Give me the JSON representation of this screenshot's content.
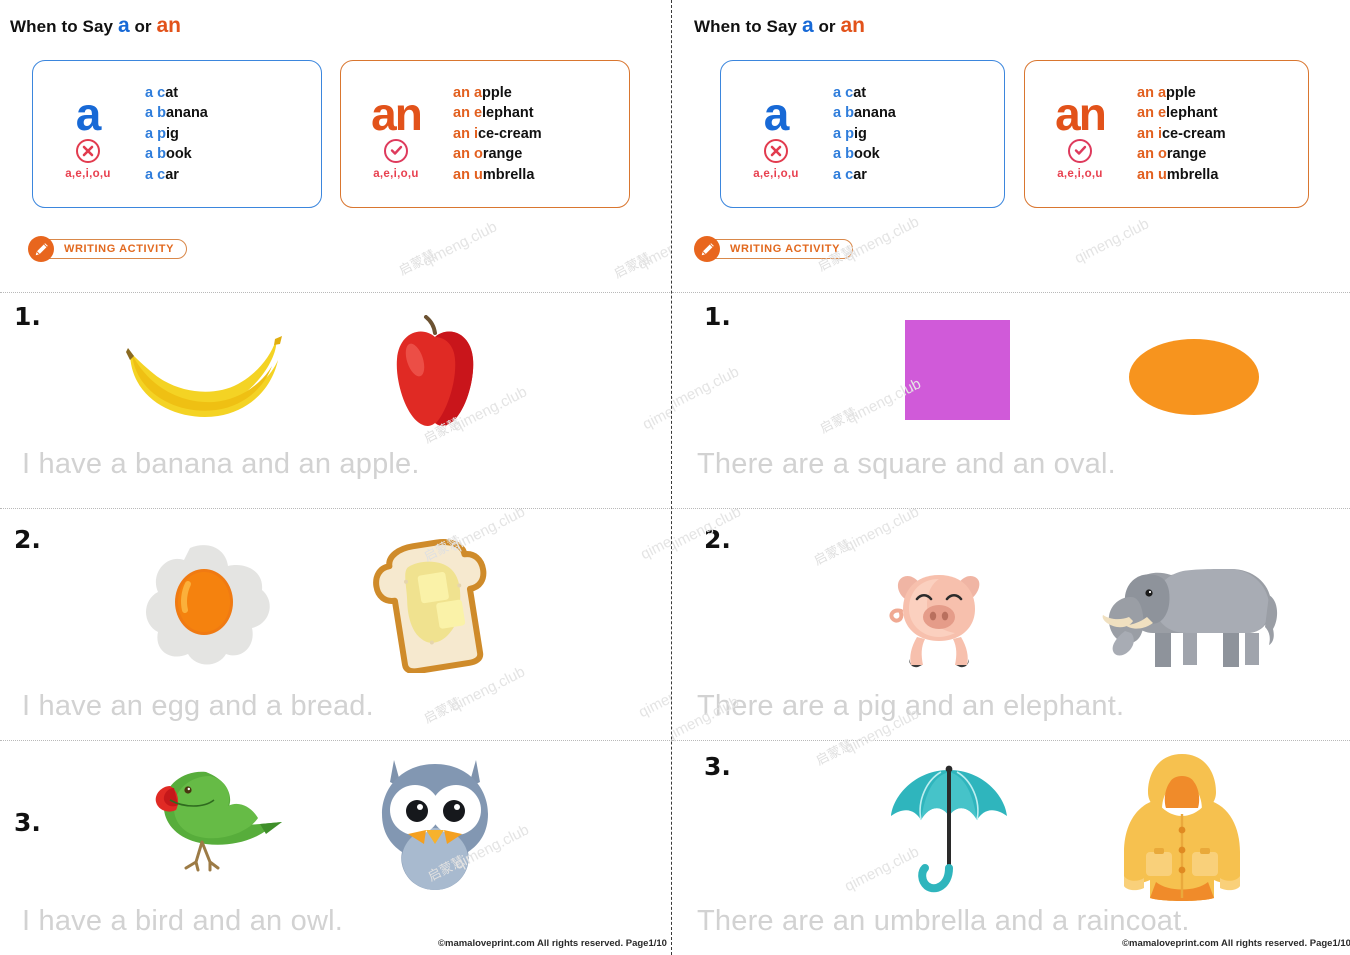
{
  "document": {
    "footer_note": "©mamaloveprint.com All rights reserved. Page1/10",
    "watermark_latin": "qimeng.club",
    "watermark_cjk": "启蒙慧"
  },
  "colors": {
    "blue": "#1769d6",
    "blue_light": "#2f7ddb",
    "orange": "#e2521a",
    "orange_light": "#e2601f",
    "red": "#e8404f",
    "badge_orange": "#e8661e",
    "sentence_gray": "#d2d2d2"
  },
  "header": {
    "title_prefix": "When to Say ",
    "title_a": "a",
    "title_or": " or ",
    "title_an": "an",
    "box_a": {
      "big_label": "a",
      "mark_icon": "cross-circle-icon",
      "vowels": "a,e,i,o,u",
      "examples": [
        {
          "article": "a",
          "initial": "c",
          "rest": "at"
        },
        {
          "article": "a",
          "initial": "b",
          "rest": "anana"
        },
        {
          "article": "a",
          "initial": "p",
          "rest": "ig"
        },
        {
          "article": "a",
          "initial": "b",
          "rest": "ook"
        },
        {
          "article": "a",
          "initial": "c",
          "rest": "ar"
        }
      ]
    },
    "box_an": {
      "big_label": "an",
      "mark_icon": "check-circle-icon",
      "vowels": "a,e,i,o,u",
      "examples": [
        {
          "article": "an",
          "initial": "a",
          "rest": "pple"
        },
        {
          "article": "an",
          "initial": "e",
          "rest": "lephant"
        },
        {
          "article": "an",
          "initial": "i",
          "rest": "ce-cream"
        },
        {
          "article": "an",
          "initial": "o",
          "rest": "range"
        },
        {
          "article": "an",
          "initial": "u",
          "rest": "mbrella"
        }
      ]
    },
    "badge": {
      "icon": "pencil-icon",
      "label": "WRITING ACTIVITY"
    }
  },
  "left_page": {
    "rows": [
      {
        "number": "1.",
        "sentence": "I have a banana and an apple.",
        "pictures": [
          "banana-illustration",
          "apple-illustration"
        ]
      },
      {
        "number": "2.",
        "sentence": "I have an egg and a bread.",
        "pictures": [
          "fried-egg-illustration",
          "toast-bread-illustration"
        ]
      },
      {
        "number": "3.",
        "sentence": "I have a bird and an owl.",
        "pictures": [
          "parrot-bird-illustration",
          "owl-illustration"
        ]
      }
    ]
  },
  "right_page": {
    "rows": [
      {
        "number": "1.",
        "sentence": "There are a square and an oval.",
        "pictures": [
          "magenta-square-shape",
          "orange-oval-shape"
        ]
      },
      {
        "number": "2.",
        "sentence": "There are a pig and an elephant.",
        "pictures": [
          "pig-illustration",
          "elephant-illustration"
        ]
      },
      {
        "number": "3.",
        "sentence": "There are an umbrella and a raincoat.",
        "pictures": [
          "umbrella-illustration",
          "raincoat-illustration"
        ]
      }
    ]
  }
}
